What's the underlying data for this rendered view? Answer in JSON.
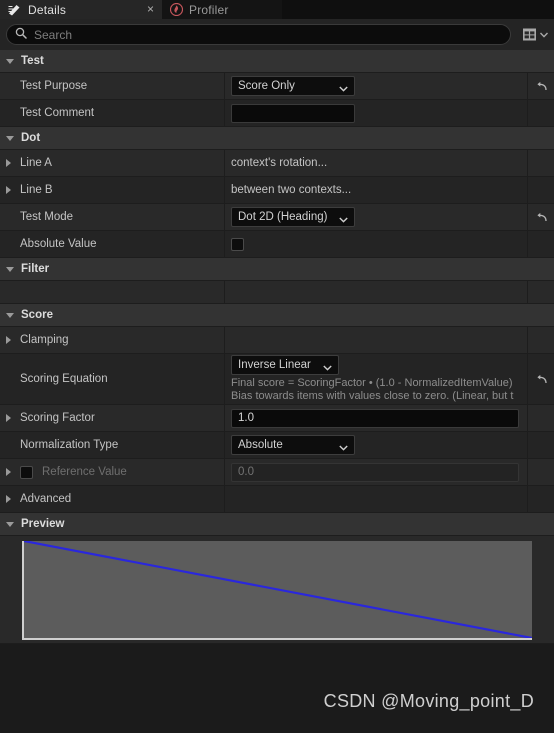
{
  "tabs": [
    {
      "label": "Details",
      "icon": "details-icon",
      "active": true,
      "close": "×"
    },
    {
      "label": "Profiler",
      "icon": "profiler-flame-icon",
      "active": false
    }
  ],
  "search": {
    "placeholder": "Search",
    "value": "",
    "icon": "search-icon",
    "grid_icon": "grid-view-icon",
    "chevron_icon": "chevron-down-icon"
  },
  "sections": {
    "test": {
      "title": "Test",
      "rows": {
        "test_purpose": {
          "label": "Test Purpose",
          "value": "Score Only"
        },
        "test_comment": {
          "label": "Test Comment",
          "value": ""
        }
      }
    },
    "dot": {
      "title": "Dot",
      "rows": {
        "line_a": {
          "label": "Line A",
          "value": "context's rotation..."
        },
        "line_b": {
          "label": "Line B",
          "value": "between two contexts..."
        },
        "test_mode": {
          "label": "Test Mode",
          "value": "Dot 2D (Heading)"
        },
        "absolute_value": {
          "label": "Absolute Value",
          "checked": false
        }
      }
    },
    "filter": {
      "title": "Filter"
    },
    "score": {
      "title": "Score",
      "rows": {
        "clamping": {
          "label": "Clamping"
        },
        "scoring_equation": {
          "label": "Scoring Equation",
          "value": "Inverse Linear",
          "desc_line1": "Final score = ScoringFactor • (1.0 - NormalizedItemValue)",
          "desc_line2": "Bias towards items with values close to zero.  (Linear, but t"
        },
        "scoring_factor": {
          "label": "Scoring Factor",
          "value": "1.0"
        },
        "normalization_type": {
          "label": "Normalization Type",
          "value": "Absolute"
        },
        "reference_value": {
          "label": "Reference Value",
          "value": "0.0",
          "checked": false
        },
        "advanced": {
          "label": "Advanced"
        }
      }
    },
    "preview": {
      "title": "Preview"
    }
  },
  "chart_data": {
    "type": "line",
    "title": "Preview",
    "xlabel": "",
    "ylabel": "",
    "x": [
      0,
      1
    ],
    "series": [
      {
        "name": "Inverse Linear",
        "values": [
          1.0,
          0.0
        ],
        "color": "#2a27dd"
      }
    ],
    "xlim": [
      0,
      1
    ],
    "ylim": [
      0,
      1
    ],
    "grid": false,
    "legend": "none",
    "plot_background": "#5c5c5c",
    "axis_color": "#cfcfcf"
  },
  "footer": {
    "watermark": "CSDN @Moving_point_D"
  },
  "colors": {
    "panel_bg": "#292929",
    "category_header": "#333333",
    "field_bg": "#0d0d0d",
    "accent_line": "#2a27dd"
  }
}
